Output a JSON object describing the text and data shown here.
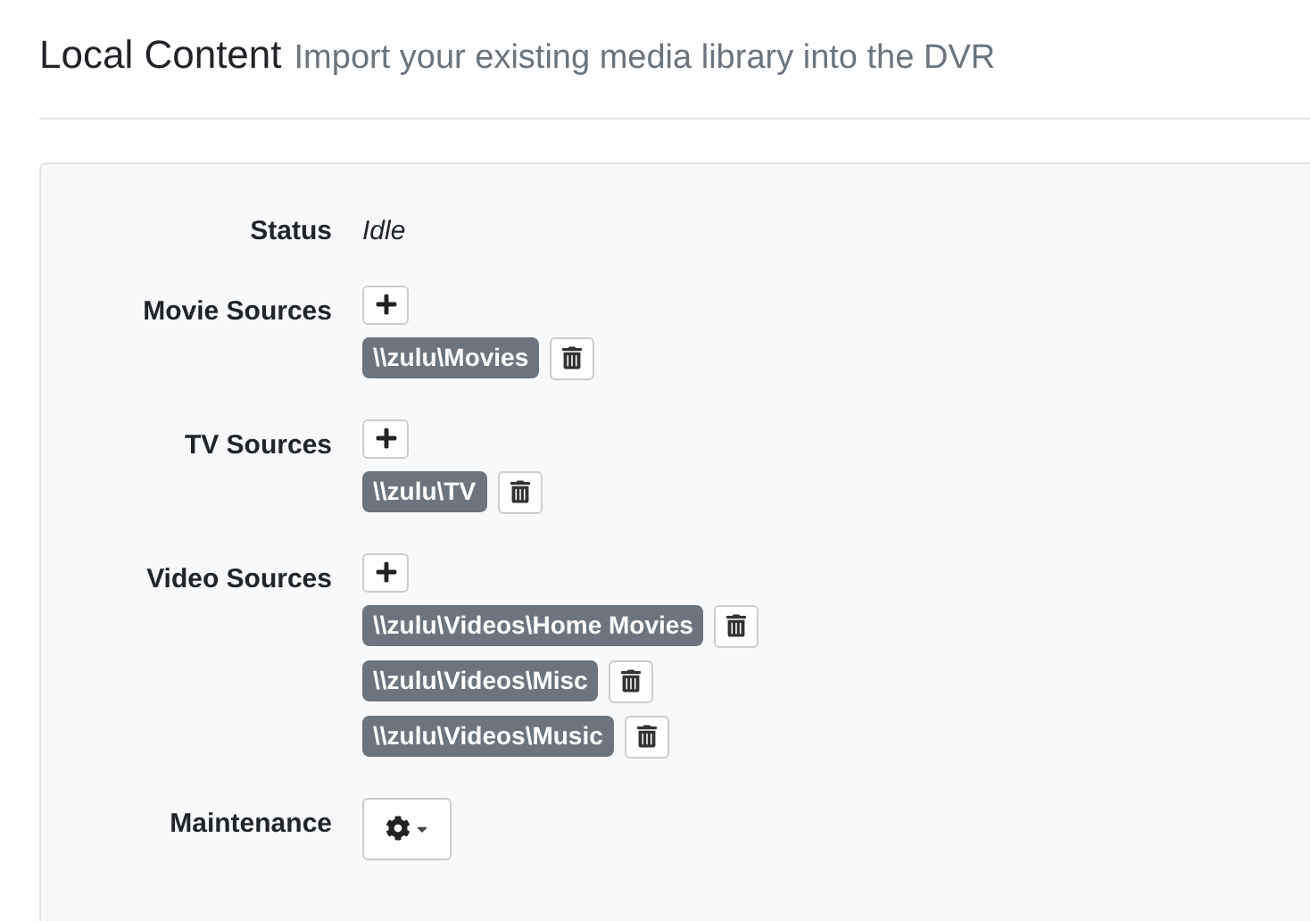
{
  "header": {
    "title": "Local Content",
    "subtitle": "Import your existing media library into the DVR"
  },
  "status": {
    "label": "Status",
    "value": "Idle"
  },
  "sources": [
    {
      "label": "Movie Sources",
      "paths": [
        "\\\\zulu\\Movies"
      ]
    },
    {
      "label": "TV Sources",
      "paths": [
        "\\\\zulu\\TV"
      ]
    },
    {
      "label": "Video Sources",
      "paths": [
        "\\\\zulu\\Videos\\Home Movies",
        "\\\\zulu\\Videos\\Misc",
        "\\\\zulu\\Videos\\Music"
      ]
    }
  ],
  "maintenance": {
    "label": "Maintenance"
  }
}
